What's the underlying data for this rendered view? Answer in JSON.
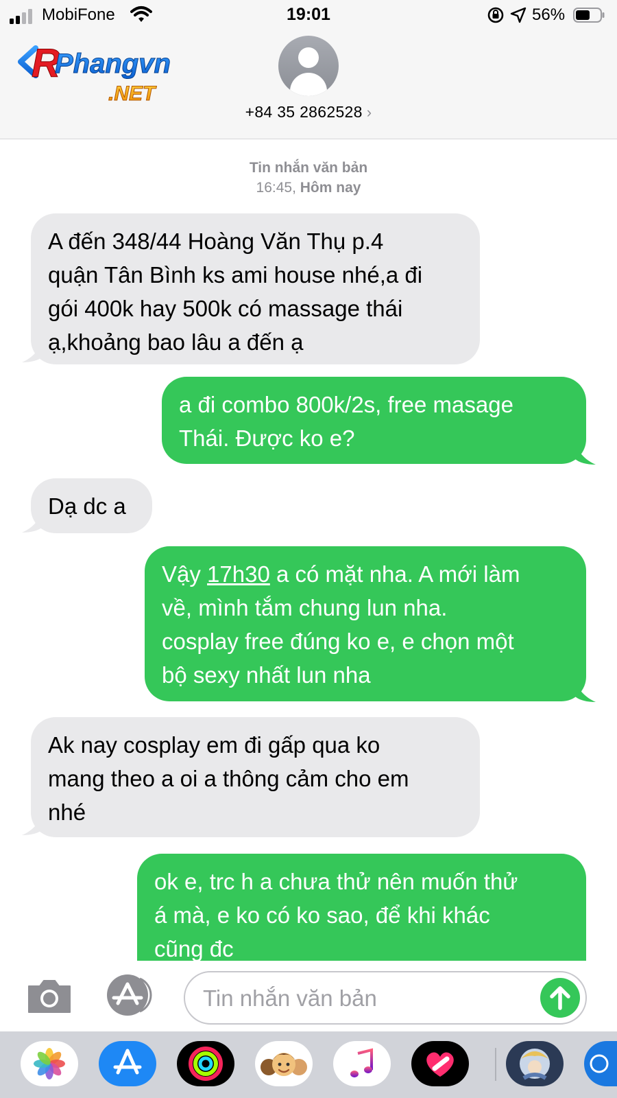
{
  "status_bar": {
    "carrier": "MobiFone",
    "time": "19:01",
    "battery": "56%"
  },
  "header": {
    "watermark_line1": "Phangvn",
    "watermark_line2": ".NET",
    "contact": "+84 35 2862528",
    "contact_chevron": "›"
  },
  "thread": {
    "meta_label": "Tin nhắn văn bản",
    "meta_time": "16:45,",
    "meta_day": "Hôm nay",
    "messages": [
      {
        "dir": "in",
        "lines": [
          "A đến 348/44 Hoàng Văn Thụ p.4",
          "quận Tân Bình ks ami house nhé,a đi",
          "gói 400k hay 500k có massage thái",
          "ạ,khoảng bao lâu a đến ạ"
        ]
      },
      {
        "dir": "out",
        "lines": [
          "a đi combo 800k/2s, free masage",
          "Thái. Được ko e?"
        ]
      },
      {
        "dir": "in",
        "lines": [
          "Dạ dc a"
        ]
      },
      {
        "dir": "out",
        "line1_pre": "Vậy ",
        "line1_link": "17h30",
        "line1_post": " a có mặt nha. A mới làm",
        "lines": [
          "về, mình tắm chung lun nha.",
          "cosplay free đúng ko e, e chọn một",
          "bộ sexy nhất lun nha"
        ]
      },
      {
        "dir": "in",
        "lines": [
          "Ak nay cosplay em đi gấp qua ko",
          "mang theo a oi a thông cảm cho em",
          "nhé"
        ]
      },
      {
        "dir": "out",
        "lines": [
          "ok e, trc h a chưa thử nên muốn thử",
          "á mà, e ko có ko sao, để khi khác",
          "cũng đc"
        ]
      }
    ]
  },
  "composer": {
    "placeholder": "Tin nhắn văn bản"
  },
  "drawer": {
    "apps": [
      "photos-icon",
      "app-store-icon",
      "activity-icon",
      "memoji-icon",
      "music-icon",
      "digital-touch-icon",
      "game-icon",
      "more-icon"
    ]
  },
  "colors": {
    "outgoing": "#35c759",
    "incoming": "#e9e9eb",
    "chrome": "#f6f6f6"
  }
}
